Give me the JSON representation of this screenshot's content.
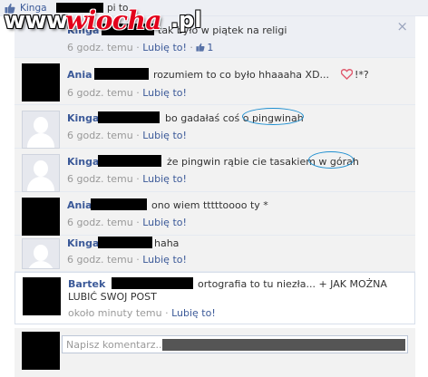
{
  "watermark": {
    "prefix": "www.",
    "brand": "wiocha",
    "tld": ".pl"
  },
  "likes_bar": {
    "liker": "Kinga",
    "rest": "pi to."
  },
  "comments": [
    {
      "author": "Kinga",
      "text": "tak było w piątek na religi",
      "time": "6 godz. temu",
      "like": "Lubię to!",
      "like_count": "1"
    },
    {
      "author": "Ania",
      "text": "rozumiem to co było hhaaaha XD...",
      "emote": "!*?",
      "time": "6 godz. temu",
      "like": "Lubię to!"
    },
    {
      "author": "Kinga",
      "text": "bo gadałaś coś o pingwinah",
      "time": "6 godz. temu",
      "like": "Lubię to!"
    },
    {
      "author": "Kinga",
      "text": "że pingwin rąbie cie tasakiem w górah",
      "time": "6 godz. temu",
      "like": "Lubię to!"
    },
    {
      "author": "Ania",
      "text": "ono wiem tttttoooo ty *",
      "time": "6 godz. temu",
      "like": "Lubię to!"
    },
    {
      "author": "Kinga",
      "text": "haha",
      "time": "6 godz. temu",
      "like": "Lubię to!"
    }
  ],
  "bartek": {
    "author": "Bartek",
    "text": "ortografia to tu niezła... + JAK MOŻNA",
    "text2": "LUBIĆ SWOJ POST",
    "time": "około minuty temu",
    "like": "Lubię to!"
  },
  "composer": {
    "placeholder": "Napisz komentarz..."
  },
  "separator": "·",
  "colors": {
    "link": "#3b5998",
    "circle": "#1f8fd0",
    "heart": "#e05a6e",
    "brand": "#e3001b"
  }
}
